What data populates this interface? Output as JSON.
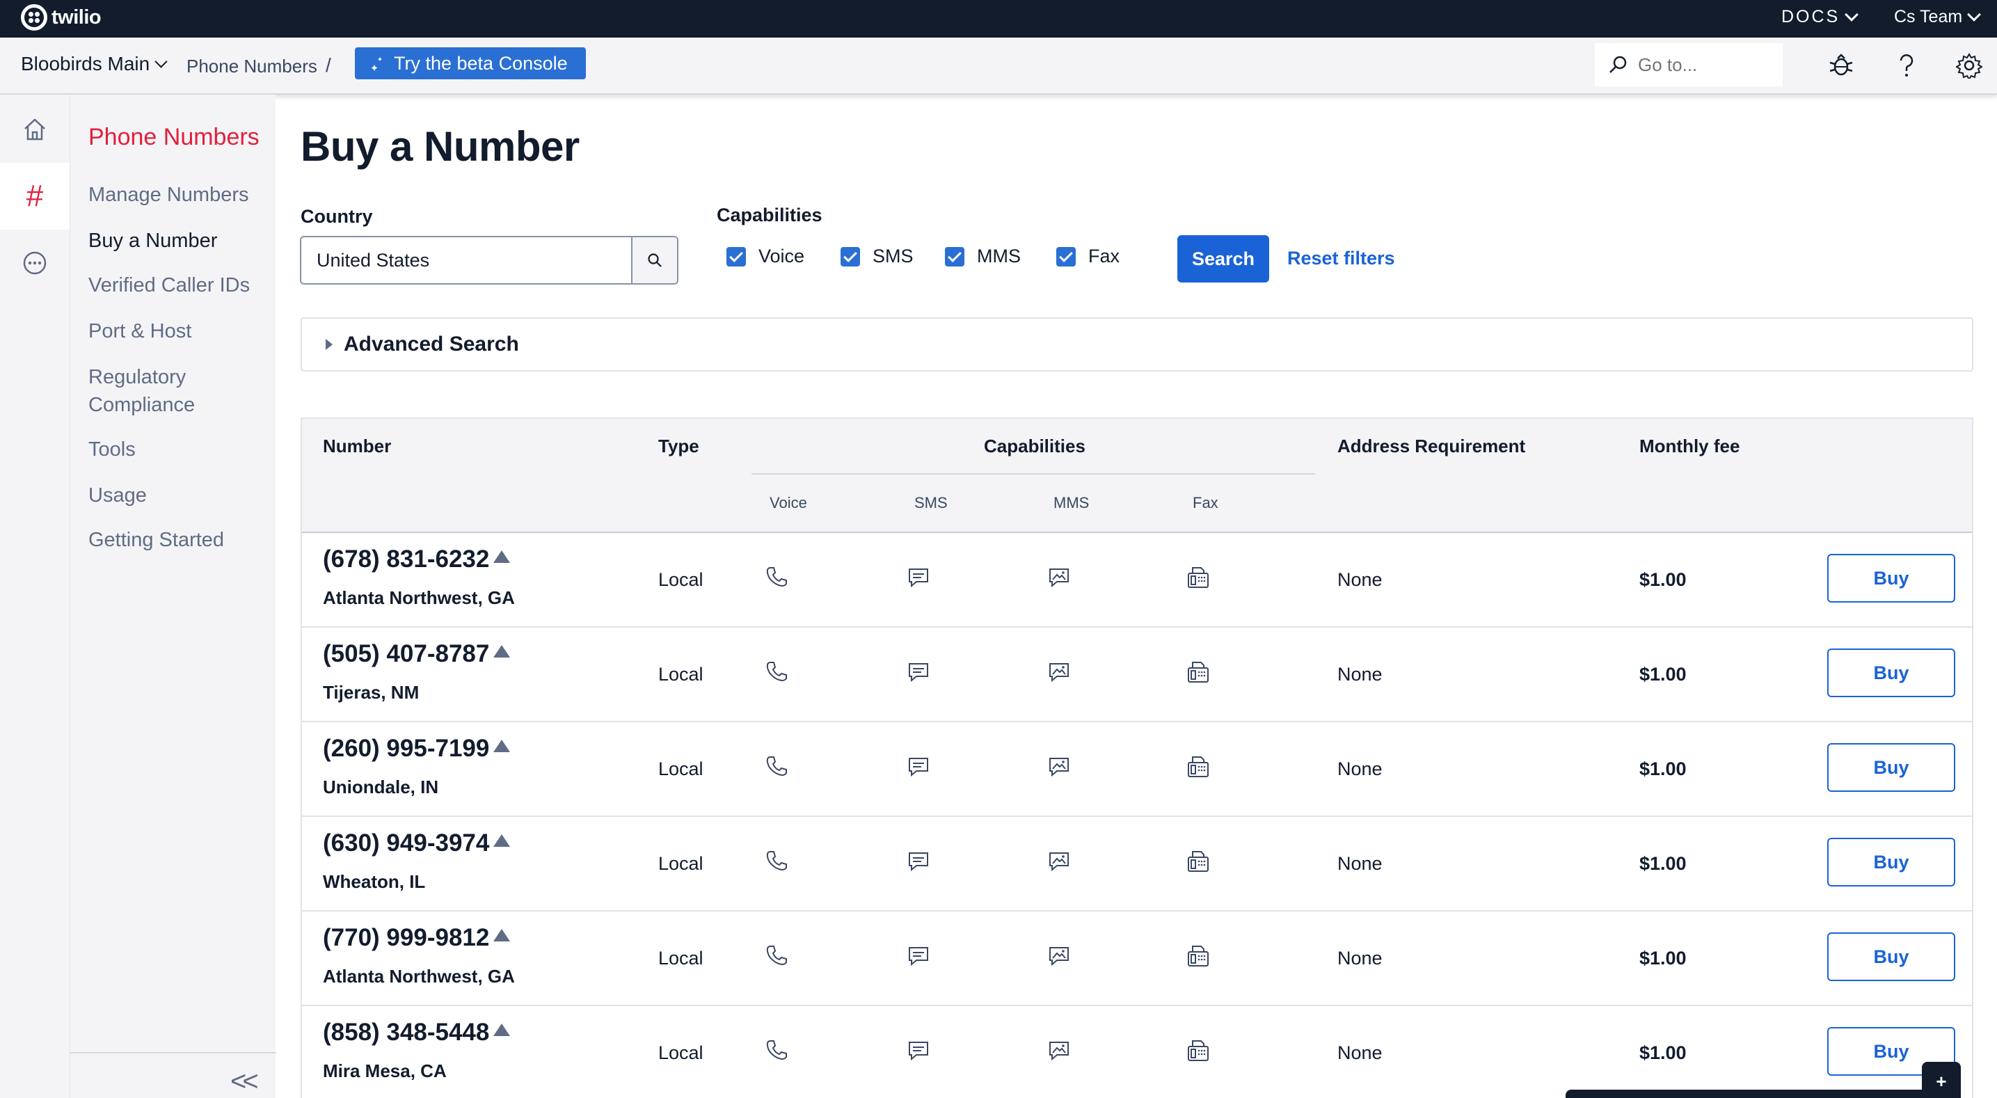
{
  "topbar": {
    "brand": "twilio",
    "docs_label": "DOCS",
    "team_label": "Cs Team"
  },
  "subbar": {
    "account": "Bloobirds Main",
    "breadcrumb": "Phone Numbers",
    "breadcrumb_sep": "/",
    "beta_button": "Try the beta Console",
    "goto_placeholder": "Go to..."
  },
  "rail": {
    "items": [
      "home-icon",
      "hash-icon",
      "more-icon"
    ],
    "hash_glyph": "#"
  },
  "subnav": {
    "title": "Phone Numbers",
    "items": [
      "Manage Numbers",
      "Buy a Number",
      "Verified Caller IDs",
      "Port & Host",
      "Regulatory",
      "Compliance",
      "Tools",
      "Usage",
      "Getting Started"
    ],
    "collapse": "<<"
  },
  "main": {
    "title": "Buy a Number",
    "country_label": "Country",
    "country_value": "United States",
    "capabilities_label": "Capabilities",
    "capabilities": [
      {
        "label": "Voice",
        "checked": true
      },
      {
        "label": "SMS",
        "checked": true
      },
      {
        "label": "MMS",
        "checked": true
      },
      {
        "label": "Fax",
        "checked": true
      }
    ],
    "search_button": "Search",
    "reset_link": "Reset filters",
    "advanced_search": "Advanced Search"
  },
  "table": {
    "headers": {
      "number": "Number",
      "type": "Type",
      "capabilities": "Capabilities",
      "address": "Address Requirement",
      "fee": "Monthly fee"
    },
    "sub_headers": [
      "Voice",
      "SMS",
      "MMS",
      "Fax"
    ],
    "rows": [
      {
        "number": "(678) 831-6232",
        "location": "Atlanta Northwest, GA",
        "type": "Local",
        "address": "None",
        "fee": "$1.00",
        "action": "Buy"
      },
      {
        "number": "(505) 407-8787",
        "location": "Tijeras, NM",
        "type": "Local",
        "address": "None",
        "fee": "$1.00",
        "action": "Buy"
      },
      {
        "number": "(260) 995-7199",
        "location": "Uniondale, IN",
        "type": "Local",
        "address": "None",
        "fee": "$1.00",
        "action": "Buy"
      },
      {
        "number": "(630) 949-3974",
        "location": "Wheaton, IL",
        "type": "Local",
        "address": "None",
        "fee": "$1.00",
        "action": "Buy"
      },
      {
        "number": "(770) 999-9812",
        "location": "Atlanta Northwest, GA",
        "type": "Local",
        "address": "None",
        "fee": "$1.00",
        "action": "Buy"
      },
      {
        "number": "(858) 348-5448",
        "location": "Mira Mesa, CA",
        "type": "Local",
        "address": "None",
        "fee": "$1.00",
        "action": "Buy"
      }
    ]
  },
  "float_button": "+",
  "colors": {
    "topbar": "#121c2d",
    "accent": "#1a63d6",
    "brand_red": "#e31e3d"
  }
}
